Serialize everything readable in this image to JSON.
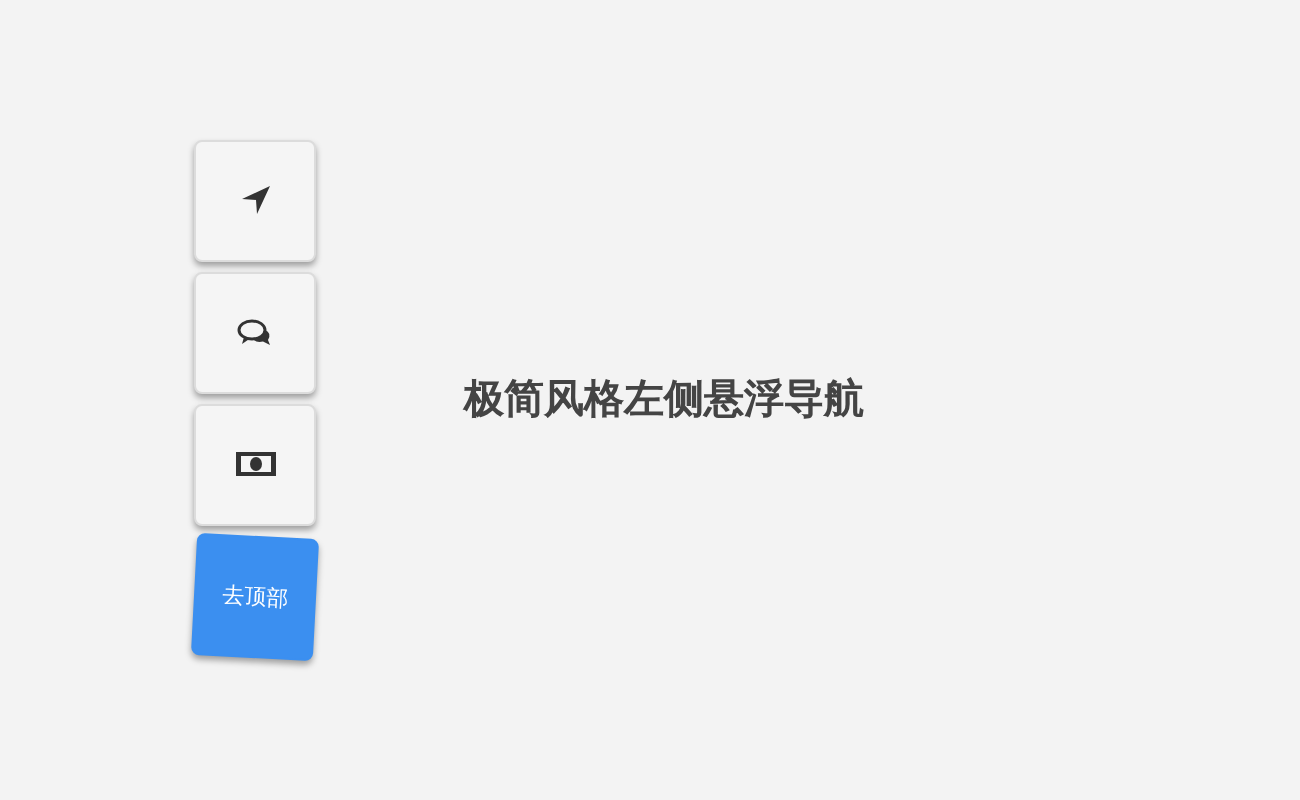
{
  "nav": [
    {
      "kind": "location",
      "selected": false
    },
    {
      "kind": "chat",
      "selected": false
    },
    {
      "kind": "money",
      "selected": false
    },
    {
      "kind": "text",
      "label": "去顶部",
      "selected": true
    }
  ],
  "title": "极简风格左侧悬浮导航"
}
